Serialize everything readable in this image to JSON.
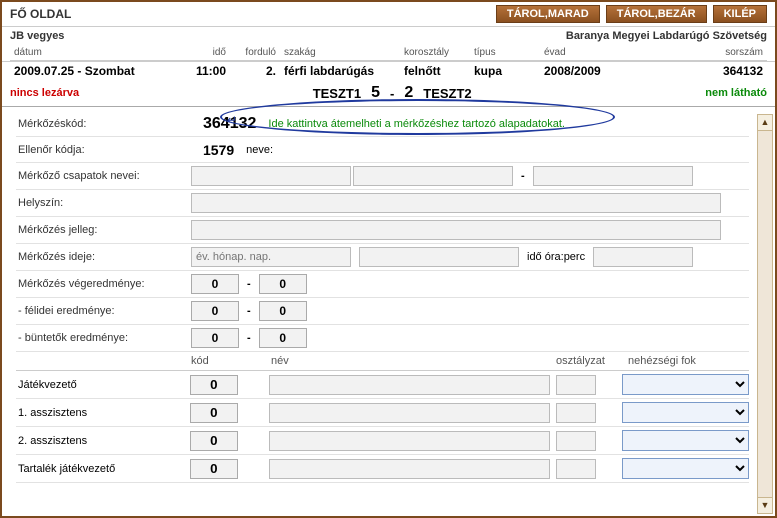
{
  "topbar": {
    "title": "FŐ OLDAL",
    "btn_save_stay": "TÁROL,MARAD",
    "btn_save_close": "TÁROL,BEZÁR",
    "btn_exit": "KILÉP"
  },
  "info": {
    "left": "JB vegyes",
    "right": "Baranya Megyei Labdarúgó Szövetség"
  },
  "headers": {
    "datum": "dátum",
    "ido": "idő",
    "fordulo": "forduló",
    "szakag": "szakág",
    "korosztaly": "korosztály",
    "tipus": "típus",
    "evad": "évad",
    "sorszam": "sorszám"
  },
  "values": {
    "datum": "2009.07.25 - Szombat",
    "ido": "11:00",
    "fordulo": "2.",
    "szakag": "férfi labdarúgás",
    "korosztaly": "felnőtt",
    "tipus": "kupa",
    "evad": "2008/2009",
    "sorszam": "364132"
  },
  "status": {
    "left": "nincs lezárva",
    "team1": "TESZT1",
    "score1": "5",
    "sep": "-",
    "score2": "2",
    "team2": "TESZT2",
    "right": "nem látható"
  },
  "form": {
    "merkozeskod_lbl": "Mérkőzéskód:",
    "merkozeskod_val": "364132",
    "hint": "Ide kattintva átemelheti a mérkőzéshez tartozó alapadatokat.",
    "ellenor_lbl": "Ellenőr kódja:",
    "ellenor_val": "1579",
    "neve_lbl": "neve:",
    "csapatok_lbl": "Mérkőző csapatok nevei:",
    "csapat_sep": "-",
    "helyszin_lbl": "Helyszín:",
    "jelleg_lbl": "Mérkőzés jelleg:",
    "ideje_lbl": "Mérkőzés ideje:",
    "ideje_ph": "év. hónap. nap.",
    "ido_lbl": "idő óra:perc",
    "vegeredmeny_lbl": "Mérkőzés végeredménye:",
    "veg1": "0",
    "veg2": "0",
    "felidei_lbl": "- félidei eredménye:",
    "fel1": "0",
    "fel2": "0",
    "bunteto_lbl": "- büntetők eredménye:",
    "bun1": "0",
    "bun2": "0"
  },
  "rolehead": {
    "kod": "kód",
    "nev": "név",
    "osztalyzat": "osztályzat",
    "nehezsegi": "nehézségi fok"
  },
  "roles": [
    {
      "label": "Játékvezető",
      "kod": "0"
    },
    {
      "label": "1. asszisztens",
      "kod": "0"
    },
    {
      "label": "2. asszisztens",
      "kod": "0"
    },
    {
      "label": "Tartalék játékvezető",
      "kod": "0"
    }
  ]
}
